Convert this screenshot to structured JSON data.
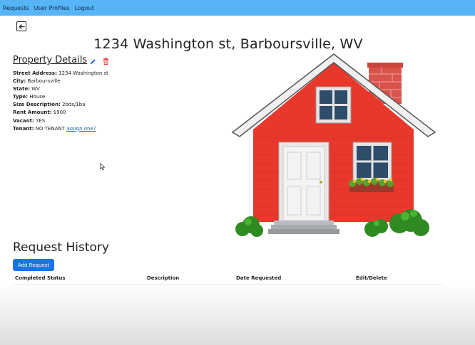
{
  "nav": {
    "items": [
      {
        "label": "Requests"
      },
      {
        "label": "User Profiles"
      },
      {
        "label": "Logout"
      }
    ]
  },
  "page": {
    "title": "1234 Washington st, Barboursville, WV"
  },
  "property": {
    "section_title": "Property Details",
    "details": [
      {
        "label": "Street Address:",
        "value": " 1234 Washington st"
      },
      {
        "label": "City:",
        "value": " Barboursville"
      },
      {
        "label": "State:",
        "value": " WV"
      },
      {
        "label": "Type:",
        "value": " House"
      },
      {
        "label": "Size Description:",
        "value": " 2bds/1ba"
      },
      {
        "label": "Rent Amount:",
        "value": " $900"
      },
      {
        "label": "Vacant:",
        "value": " YES"
      },
      {
        "label": "Tenant:",
        "value": " NO TENANT "
      }
    ],
    "assign_link": "assign one?"
  },
  "history": {
    "title": "Request History",
    "add_button": "Add Request",
    "columns": [
      "Completed Status",
      "Description",
      "Date Requested",
      "Edit/Delete"
    ]
  },
  "colors": {
    "navbar": "#56b4f7",
    "primary_button": "#1a73e8",
    "delete_icon": "#e53935",
    "edit_icon": "#1a73e8"
  },
  "icons": {
    "back": "arrow-left-icon",
    "edit": "pencil-icon",
    "delete": "trash-icon"
  }
}
